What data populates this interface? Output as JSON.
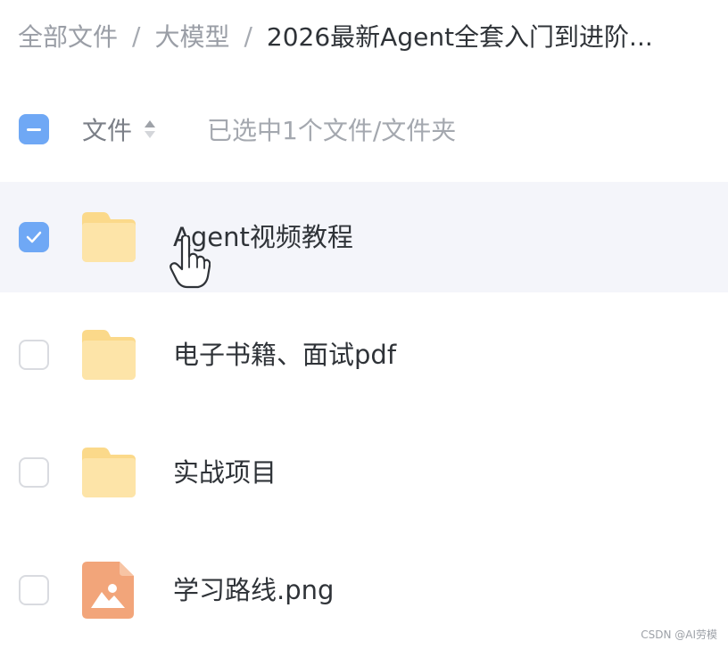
{
  "breadcrumb": {
    "items": [
      "全部文件",
      "大模型"
    ],
    "current": "2026最新Agent全套入门到进阶...",
    "separator": "/"
  },
  "list_header": {
    "sort_label": "文件",
    "selection_text": "已选中1个文件/文件夹"
  },
  "files": [
    {
      "name": "Agent视频教程",
      "type": "folder",
      "selected": true
    },
    {
      "name": "电子书籍、面试pdf",
      "type": "folder",
      "selected": false
    },
    {
      "name": "实战项目",
      "type": "folder",
      "selected": false
    },
    {
      "name": "学习路线.png",
      "type": "image",
      "selected": false
    }
  ],
  "watermark": "CSDN @AI劳模",
  "colors": {
    "accent": "#6fa8f5",
    "selected_row": "#f4f5fa",
    "folder": "#fbd98a",
    "image_icon": "#f2a57a"
  }
}
